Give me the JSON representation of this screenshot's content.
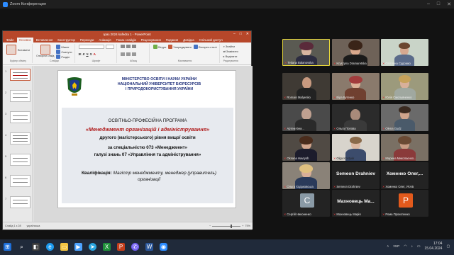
{
  "window": {
    "title": "Zoom Конференция",
    "controls": [
      "–",
      "□",
      "✕"
    ]
  },
  "ppt": {
    "title": "зраз 2024 kafedra 1 - PowerPoint",
    "tabs": [
      "Файл",
      "Основне",
      "Вставлення",
      "Конструктор",
      "Переходи",
      "Анімація",
      "Показ слайдів",
      "Рецензування",
      "Подання",
      "Довідка",
      "Спільний доступ"
    ],
    "active_tab": "Основне",
    "ribbon": {
      "paste": "Вставити",
      "new_slide": "Створити слайд",
      "layout": "Макет",
      "reset": "Скинути",
      "section": "Розділ",
      "font_name": "",
      "font_size": "",
      "shapes": "Фігури",
      "arrange": "Упорядкувати",
      "quick_styles": "Експрес-стилі",
      "find": "Знайти",
      "replace": "Замінити",
      "select": "Виділити",
      "g_clipboard": "Буфер обміну",
      "g_slides": "Слайди",
      "g_font": "Шрифт",
      "g_paragraph": "Абзац",
      "g_drawing": "Малювання",
      "g_editing": "Редагування"
    },
    "thumbs": [
      "1",
      "2",
      "3",
      "4",
      "5",
      "6",
      "7"
    ],
    "slide": {
      "ministry": [
        "МІНІСТЕРСТВО ОСВІТИ І НАУКИ УКРАЇНИ",
        "НАЦІОНАЛЬНИЙ УНІВЕРСИТЕТ БІОРЕСУРСІВ",
        "І ПРИРОДОКОРИСТУВАННЯ УКРАЇНИ"
      ],
      "program_label": "ОСВІТНЬО-ПРОФЕСІЙНА ПРОГРАМА",
      "program_title": "«Менеджмент організацій і адміністрування»",
      "lines": [
        "другого (магістерського) рівня вищої освіти",
        "за спеціальністю 073 «Менеджмент»",
        "галузі знань 07 «Управління та адміністрування»"
      ],
      "qual_label": "Кваліфікація:",
      "qual_text": "Магістр менеджменту, менеджер (управитель) організації"
    },
    "status": {
      "slide_info": "Слайд 1 з 28",
      "language": "українська",
      "zoom": "75%"
    }
  },
  "participants": [
    {
      "name": "Tetiana Balanovska",
      "active": true
    },
    {
      "name": "Kryszyna Dramaretska"
    },
    {
      "name": "Світлана Судомко"
    },
    {
      "name": "Romain Malyenko"
    },
    {
      "name": "Віра Бутенко"
    },
    {
      "name": "Юлія Смольяненко"
    },
    {
      "name": "Артем Кем..."
    },
    {
      "name": "Ольга Попова"
    },
    {
      "name": "Olena Gudz"
    },
    {
      "name": "Oksana Havrysh"
    },
    {
      "name": "Olga Kostyuk"
    },
    {
      "name": "Марина Миколаєнко..."
    },
    {
      "name": "Ольга Ходаковська"
    },
    {
      "name": "Semeon Drahniev",
      "big": "Semeon Drahniev"
    },
    {
      "name": "Хоменко Олег, УКАБ",
      "big": "Хоменко Олег,..."
    },
    {
      "name": "Сергій Никоненко",
      "avatar": "С",
      "avatar_color": "#8a9aa6"
    },
    {
      "name": "Махновець Марія",
      "big": "Махновець Ма..."
    },
    {
      "name": "Рома Прокопенко",
      "avatar": "Р",
      "avatar_color": "#e35a1c"
    }
  ],
  "taskbar": {
    "lang": "УКР",
    "time": "17:04",
    "date": "15.04.2024"
  }
}
